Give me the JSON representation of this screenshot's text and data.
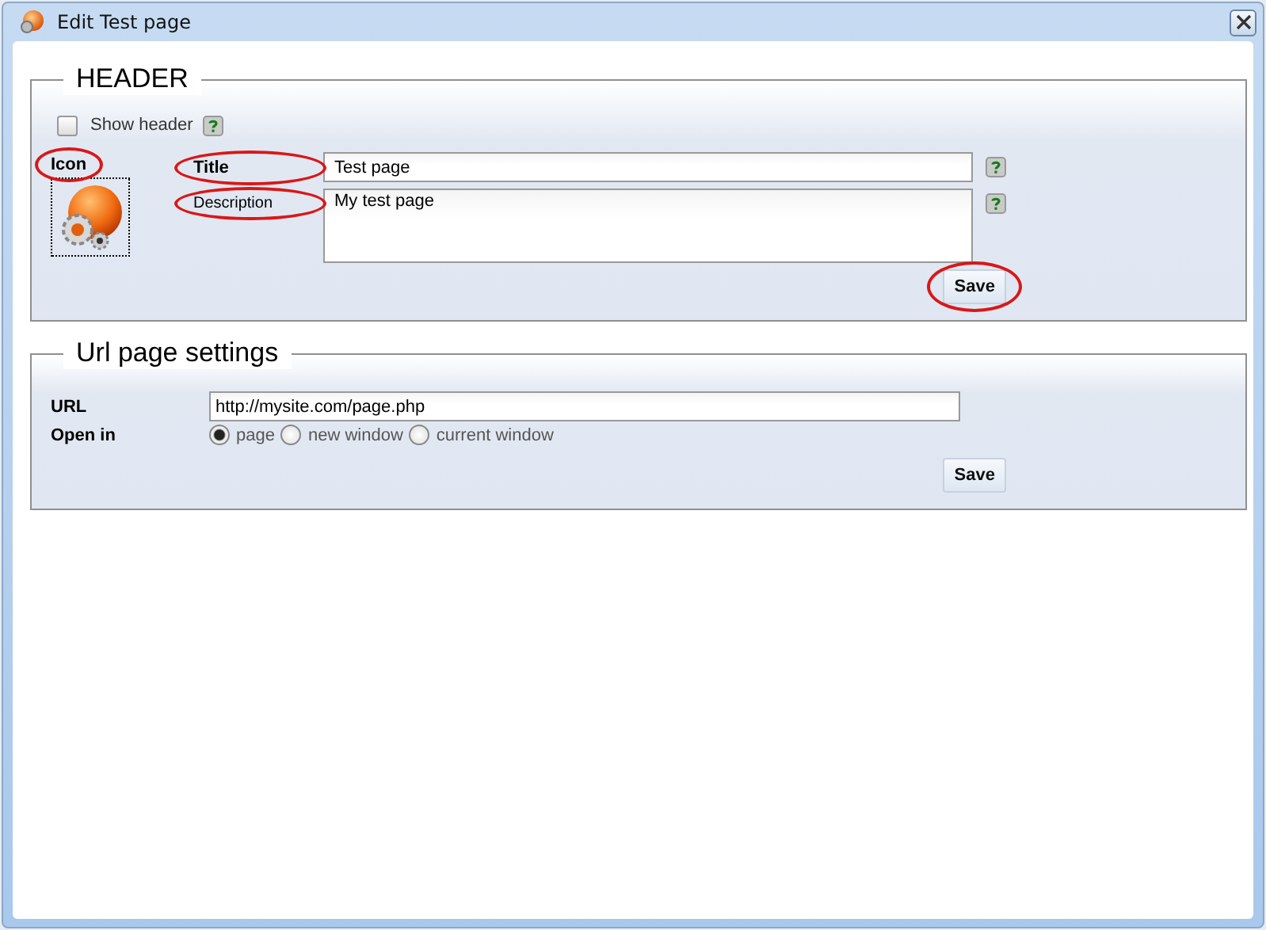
{
  "window": {
    "title": "Edit Test page"
  },
  "header_section": {
    "legend": "HEADER",
    "show_header": {
      "label": "Show header",
      "checked": false
    },
    "icon_label": {
      "text": "Icon",
      "circled": true
    },
    "fields": [
      {
        "label": "Title",
        "circled": true,
        "kind": "input",
        "value": "Test page"
      },
      {
        "label": "Description",
        "circled": true,
        "kind": "textarea",
        "value": "My test page"
      }
    ],
    "save": {
      "label": "Save",
      "circled": true
    }
  },
  "url_section": {
    "legend": "Url page settings",
    "url": {
      "label": "URL",
      "value": "http://mysite.com/page.php"
    },
    "open_in": {
      "label": "Open in",
      "options": [
        {
          "label": "page",
          "selected": true
        },
        {
          "label": "new window",
          "selected": false
        },
        {
          "label": "current window",
          "selected": false
        }
      ]
    },
    "save": {
      "label": "Save"
    }
  }
}
